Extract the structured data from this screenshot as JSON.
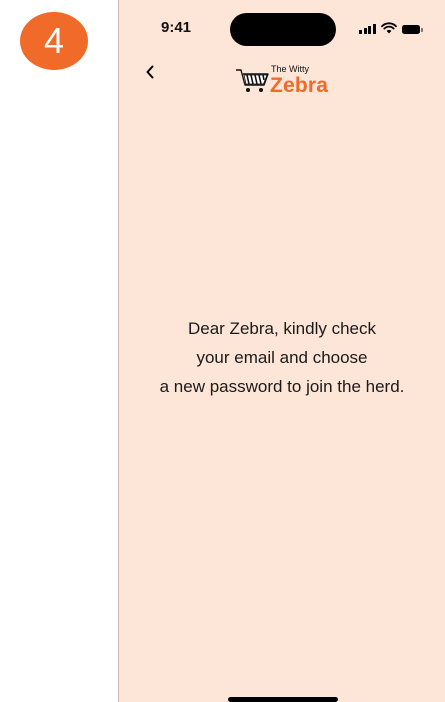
{
  "step": {
    "number": "4",
    "color": "#f06a2a"
  },
  "status_bar": {
    "time": "9:41",
    "icons": [
      "signal-icon",
      "wifi-icon",
      "battery-icon"
    ]
  },
  "nav": {
    "back_icon": "chevron-left-icon"
  },
  "brand": {
    "tagline": "The Witty",
    "name": "Zebra",
    "accent_color": "#f06a2a",
    "icon": "shopping-cart-icon"
  },
  "message": {
    "lines": [
      "Dear Zebra, kindly check",
      "your email and choose",
      "a new password to join the herd."
    ]
  },
  "colors": {
    "background": "#fde5d7"
  }
}
